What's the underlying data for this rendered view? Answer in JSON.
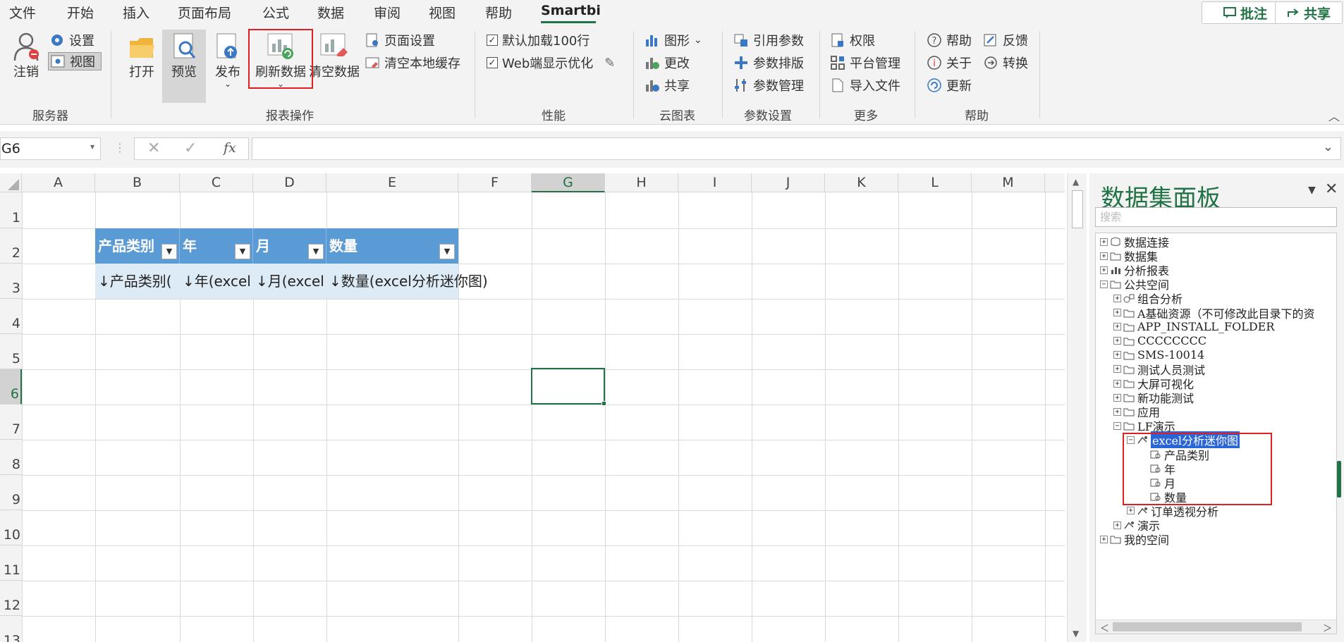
{
  "tabs": [
    "文件",
    "开始",
    "插入",
    "页面布局",
    "公式",
    "数据",
    "审阅",
    "视图",
    "帮助",
    "Smartbi"
  ],
  "active_tab": "Smartbi",
  "top_buttons": {
    "comment": "批注",
    "share": "共享"
  },
  "ribbon": {
    "server": {
      "logout": "注销",
      "settings": "设置",
      "view": "视图",
      "group": "服务器"
    },
    "report": {
      "open": "打开",
      "preview": "预览",
      "publish": "发布",
      "refresh": "刷新数据",
      "clear": "清空数据",
      "page_setup": "页面设置",
      "clear_cache": "清空本地缓存",
      "group": "报表操作"
    },
    "perf": {
      "load100": "默认加载100行",
      "web_opt": "Web端显示优化",
      "group": "性能"
    },
    "cloud": {
      "chart": "图形",
      "change": "更改",
      "share": "共享",
      "group": "云图表"
    },
    "params": {
      "ref": "引用参数",
      "layout": "参数排版",
      "manage": "参数管理",
      "group": "参数设置"
    },
    "more": {
      "perm": "权限",
      "platform": "平台管理",
      "import": "导入文件",
      "group": "更多"
    },
    "help": {
      "help": "帮助",
      "feedback": "反馈",
      "about": "关于",
      "convert": "转换",
      "update": "更新",
      "group": "帮助"
    }
  },
  "formula_bar": {
    "name_box": "G6",
    "fx": "fx",
    "value": ""
  },
  "columns": [
    "A",
    "B",
    "C",
    "D",
    "E",
    "F",
    "G",
    "H",
    "I",
    "J",
    "K",
    "L",
    "M"
  ],
  "rows": [
    "1",
    "2",
    "3",
    "4",
    "5",
    "6",
    "7",
    "8",
    "9",
    "10",
    "11",
    "12",
    "13"
  ],
  "selected_cell": "G6",
  "table": {
    "headers": [
      "产品类别",
      "年",
      "月",
      "数量"
    ],
    "cells": [
      "↓产品类别(",
      "↓年(excel",
      "↓月(excel",
      "↓数量(excel分析迷你图)"
    ]
  },
  "panel": {
    "title": "数据集面板",
    "search_placeholder": "搜索",
    "tree": [
      {
        "label": "数据连接",
        "sign": "+"
      },
      {
        "label": "数据集",
        "sign": "+"
      },
      {
        "label": "分析报表",
        "sign": "+"
      },
      {
        "label": "公共空间",
        "sign": "-"
      },
      {
        "label": "组合分析",
        "sign": "+"
      },
      {
        "label": "A基础资源（不可修改此目录下的资",
        "sign": "+"
      },
      {
        "label": "APP_INSTALL_FOLDER",
        "sign": "+"
      },
      {
        "label": "CCCCCCCC",
        "sign": "+"
      },
      {
        "label": "SMS-10014",
        "sign": "+"
      },
      {
        "label": "测试人员测试",
        "sign": "+"
      },
      {
        "label": "大屏可视化",
        "sign": "+"
      },
      {
        "label": "新功能测试",
        "sign": "+"
      },
      {
        "label": "应用",
        "sign": "+"
      },
      {
        "label": "LF演示",
        "sign": "-"
      },
      {
        "label": "excel分析迷你图",
        "sign": "-"
      },
      {
        "label": "产品类别",
        "sign": ""
      },
      {
        "label": "年",
        "sign": ""
      },
      {
        "label": "月",
        "sign": ""
      },
      {
        "label": "数量",
        "sign": ""
      },
      {
        "label": "订单透视分析",
        "sign": "+"
      },
      {
        "label": "演示",
        "sign": "+"
      },
      {
        "label": "我的空间",
        "sign": "+"
      }
    ]
  }
}
